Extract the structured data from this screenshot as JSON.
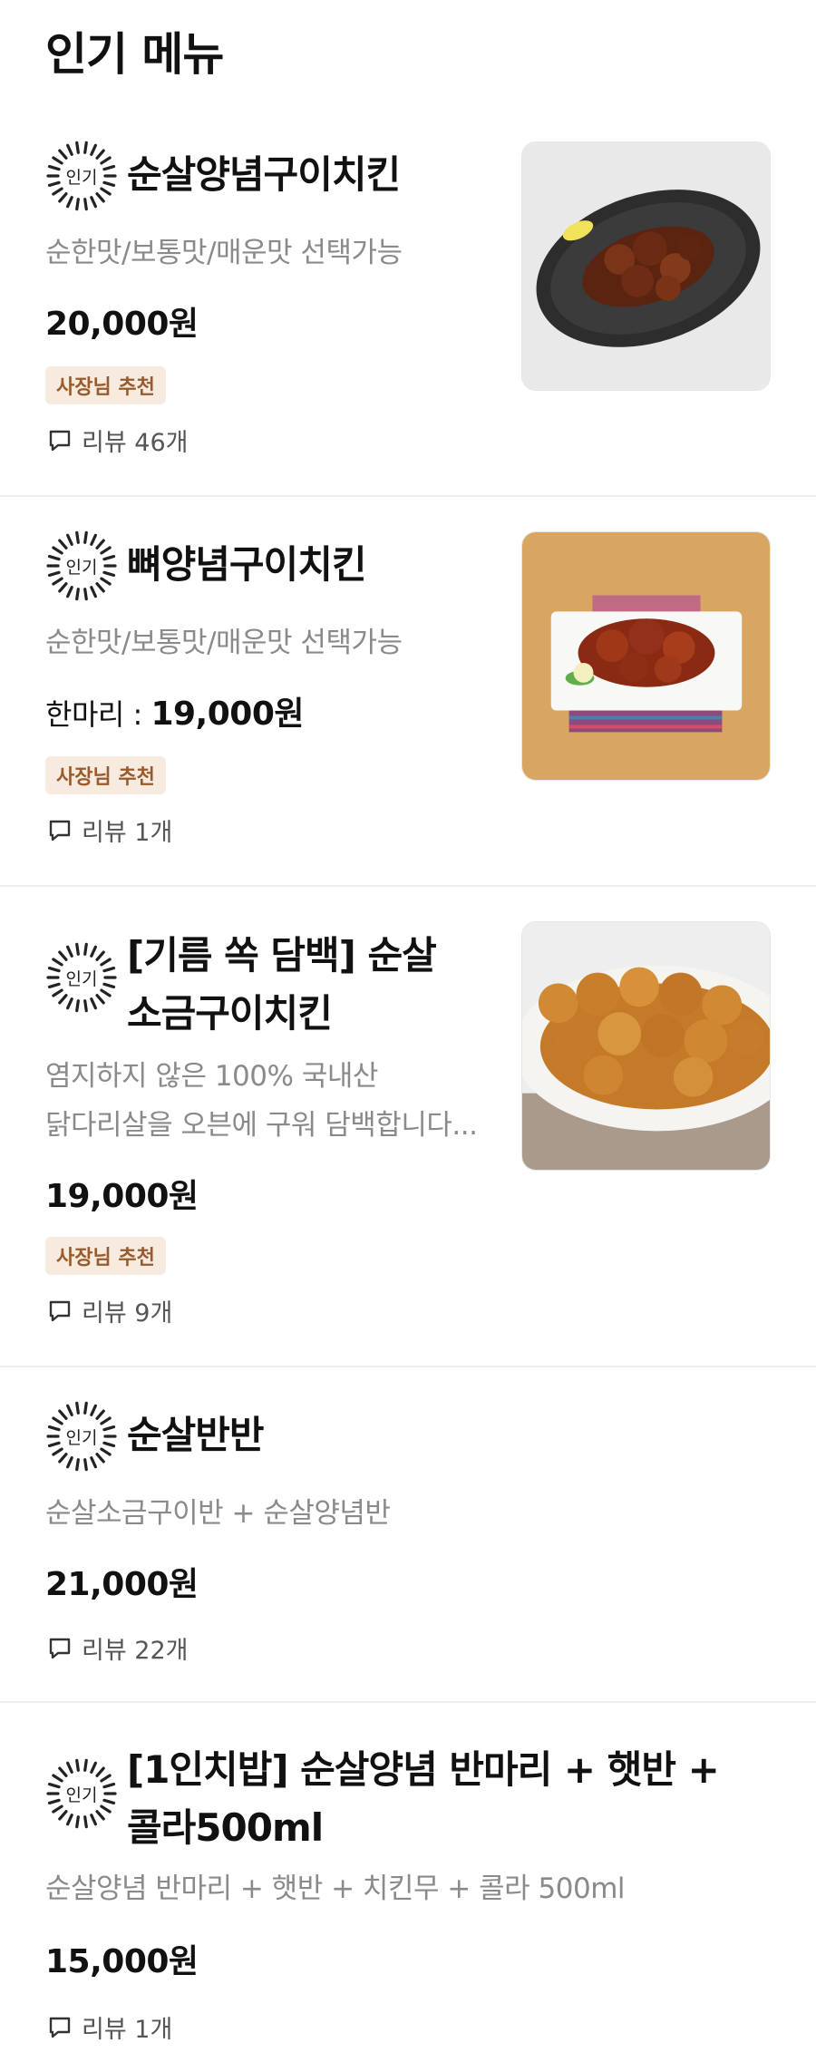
{
  "section": {
    "title": "인기 메뉴"
  },
  "badge_label": "인기",
  "items": [
    {
      "name": "순살양념구이치킨",
      "description": "순한맛/보통맛/매운맛 선택가능",
      "price_prefix": "",
      "price": "20,000원",
      "owner_badge": "사장님 추천",
      "reviews": "리뷰 46개",
      "image_icon": "seasoned-chicken-plate-photo"
    },
    {
      "name": "뼈양념구이치킨",
      "description": "순한맛/보통맛/매운맛 선택가능",
      "price_prefix": "한마리 : ",
      "price": "19,000원",
      "owner_badge": "사장님 추천",
      "reviews": "리뷰 1개",
      "image_icon": "bone-chicken-plate-photo"
    },
    {
      "name_line1": "[기름 쏙 담백] 순살",
      "name_line2": "소금구이치킨",
      "description_line1": "염지하지 않은 100% 국내산",
      "description_line2": "닭다리살을 오븐에 구워 담백합니다...",
      "price": "19,000원",
      "owner_badge": "사장님 추천",
      "reviews": "리뷰 9개",
      "image_icon": "salt-chicken-plate-photo"
    },
    {
      "name": "순살반반",
      "description": "순살소금구이반 + 순살양념반",
      "price": "21,000원",
      "reviews": "리뷰 22개"
    },
    {
      "name_line1": "[1인치밥] 순살양념 반마리 + 햇반 +",
      "name_line2": "콜라500ml",
      "description": "순살양념 반마리 + 햇반 + 치킨무 + 콜라 500ml",
      "price": "15,000원",
      "reviews": "리뷰 1개"
    }
  ],
  "colors": {
    "owner_badge_bg": "#f7ebe0",
    "owner_badge_text": "#9a5a2c",
    "description": "#8a8a8a",
    "divider": "#eeeeee"
  }
}
